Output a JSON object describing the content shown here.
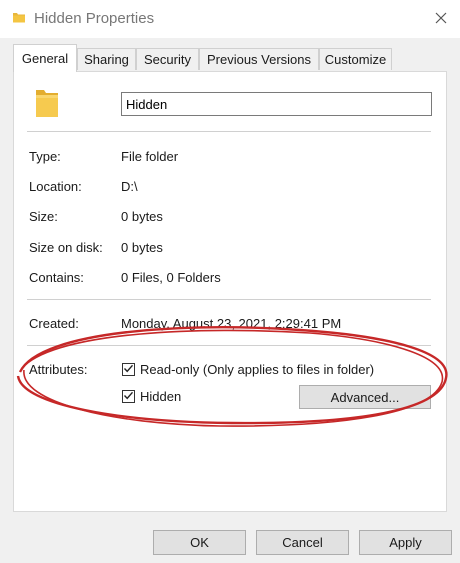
{
  "window": {
    "title": "Hidden Properties",
    "title_icon": "folder-icon",
    "close_icon": "close-icon"
  },
  "tabs": [
    {
      "label": "General",
      "active": true
    },
    {
      "label": "Sharing",
      "active": false
    },
    {
      "label": "Security",
      "active": false
    },
    {
      "label": "Previous Versions",
      "active": false
    },
    {
      "label": "Customize",
      "active": false
    }
  ],
  "general": {
    "folder_icon": "folder-icon",
    "name_value": "Hidden",
    "properties": [
      {
        "label": "Type:",
        "value": "File folder"
      },
      {
        "label": "Location:",
        "value": "D:\\"
      },
      {
        "label": "Size:",
        "value": "0 bytes"
      },
      {
        "label": "Size on disk:",
        "value": "0 bytes"
      },
      {
        "label": "Contains:",
        "value": "0 Files, 0 Folders"
      }
    ],
    "created_label": "Created:",
    "created_value": "Monday, August 23, 2021, 2:29:41 PM",
    "attributes_label": "Attributes:",
    "readonly_label": "Read-only (Only applies to files in folder)",
    "readonly_checked": true,
    "hidden_label": "Hidden",
    "hidden_checked": true,
    "advanced_label": "Advanced..."
  },
  "buttons": {
    "ok": "OK",
    "cancel": "Cancel",
    "apply": "Apply"
  },
  "colors": {
    "annotation_ellipse": "#c62828",
    "folder_yellow": "#f4c542"
  }
}
